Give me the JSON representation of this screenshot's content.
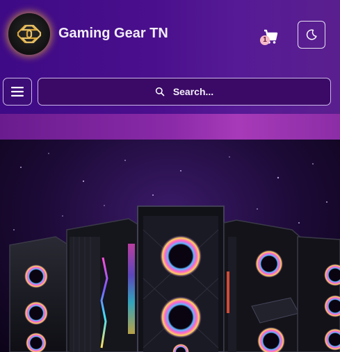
{
  "header": {
    "brand_title": "Gaming Gear TN",
    "logo_icon": "gs-monogram-logo-icon",
    "cart": {
      "icon": "cart-icon",
      "count": "1"
    },
    "theme_toggle": {
      "icon": "moon-icon"
    }
  },
  "nav": {
    "menu_icon": "hamburger-icon",
    "search": {
      "icon": "search-icon",
      "placeholder": "Search..."
    }
  },
  "hero": {
    "image": "pc-cases-showcase-image"
  },
  "colors": {
    "header_bg": "#4a0f8c",
    "accent_glow": "#ffc828",
    "text": "#f2eef8"
  }
}
